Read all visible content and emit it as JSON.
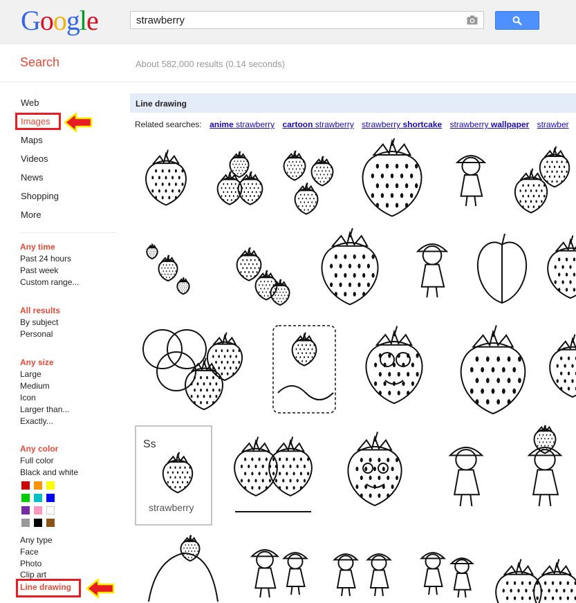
{
  "header": {
    "logo_letters": [
      {
        "ch": "G",
        "color": "#3369e8"
      },
      {
        "ch": "o",
        "color": "#d50f25"
      },
      {
        "ch": "o",
        "color": "#eeb211"
      },
      {
        "ch": "g",
        "color": "#3369e8"
      },
      {
        "ch": "l",
        "color": "#009925"
      },
      {
        "ch": "e",
        "color": "#d50f25"
      }
    ],
    "search_value": "strawberry",
    "camera_icon": "camera-icon",
    "search_button_icon": "search-icon"
  },
  "subheader": {
    "section_label": "Search",
    "result_stats": "About 582,000 results (0.14 seconds)"
  },
  "nav": {
    "items": [
      "Web",
      "Images",
      "Maps",
      "Videos",
      "News",
      "Shopping",
      "More"
    ],
    "time": {
      "heading": "Any time",
      "options": [
        "Past 24 hours",
        "Past week",
        "Custom range..."
      ]
    },
    "results": {
      "heading": "All results",
      "options": [
        "By subject",
        "Personal"
      ]
    },
    "size": {
      "heading": "Any size",
      "options": [
        "Large",
        "Medium",
        "Icon",
        "Larger than...",
        "Exactly..."
      ]
    },
    "color": {
      "heading": "Any color",
      "options": [
        "Full color",
        "Black and white"
      ],
      "swatches": [
        "#cc0000",
        "#fb940b",
        "#ffff00",
        "#00cc00",
        "#03c0c6",
        "#0000ff",
        "#762ca7",
        "#ff98bf",
        "#ffffff",
        "#999999",
        "#000000",
        "#885418"
      ]
    },
    "type": {
      "options": [
        "Any type",
        "Face",
        "Photo",
        "Clip art",
        "Line drawing"
      ]
    }
  },
  "results": {
    "bar_title": "Line drawing",
    "related_label": "Related searches:",
    "related": [
      {
        "bold": "anime",
        "normal": " strawberry",
        "order": "bold-first"
      },
      {
        "bold": "cartoon",
        "normal": " strawberry",
        "order": "bold-first"
      },
      {
        "bold": "shortcake",
        "normal": "strawberry ",
        "order": "normal-first"
      },
      {
        "bold": "wallpaper",
        "normal": "strawberry ",
        "order": "normal-first"
      },
      {
        "bold": "",
        "normal": "strawber",
        "order": "normal-first"
      }
    ]
  },
  "annotations": {
    "highlight_color": "#e81c24",
    "arrow_fill": "#e81c24",
    "arrow_stroke": "#ffee00"
  }
}
